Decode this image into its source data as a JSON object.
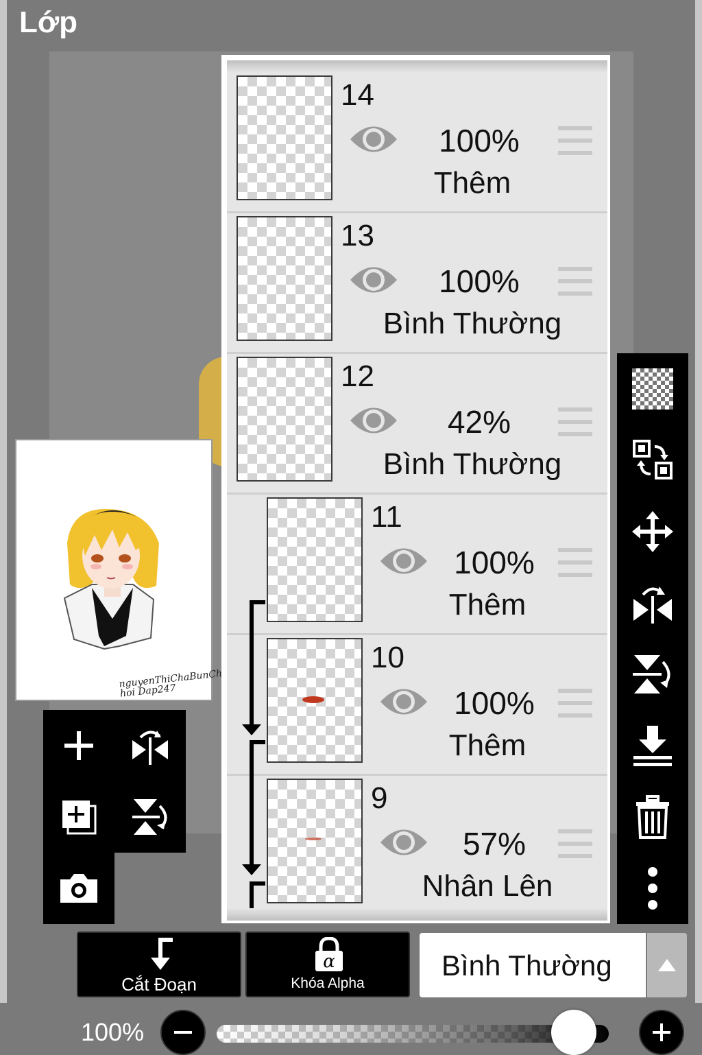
{
  "title": "Lớp",
  "preview": {
    "signature_lines": [
      "nguyenThiChaBunChee",
      "hoi Dap247"
    ]
  },
  "layers": [
    {
      "number": "14",
      "opacity": "100%",
      "blend": "Thêm",
      "clipped": false
    },
    {
      "number": "13",
      "opacity": "100%",
      "blend": "Bình Thường",
      "clipped": false
    },
    {
      "number": "12",
      "opacity": "42%",
      "blend": "Bình Thường",
      "clipped": false
    },
    {
      "number": "11",
      "opacity": "100%",
      "blend": "Thêm",
      "clipped": true
    },
    {
      "number": "10",
      "opacity": "100%",
      "blend": "Thêm",
      "clipped": true
    },
    {
      "number": "9",
      "opacity": "57%",
      "blend": "Nhân Lên",
      "clipped": true
    }
  ],
  "bottom": {
    "clip_label": "Cắt Đoạn",
    "alpha_lock_label": "Khóa Alpha",
    "blend_mode": "Bình Thường",
    "zoom": "100%",
    "opacity_slider_value": 1.0
  },
  "icons": {
    "left_tools": [
      "plus-icon",
      "flip-horizontal-icon",
      "duplicate-layer-icon",
      "flip-vertical-icon",
      "camera-icon"
    ],
    "right_tools": [
      "transparency-icon",
      "swap-layers-icon",
      "move-icon",
      "flip-horizontal-icon",
      "flip-vertical-icon",
      "merge-down-icon",
      "trash-icon",
      "more-icon"
    ]
  },
  "colors": {
    "panel_bg": "#e6e6e6",
    "toolbar_bg": "#000000",
    "hair": "#f2c12e"
  }
}
